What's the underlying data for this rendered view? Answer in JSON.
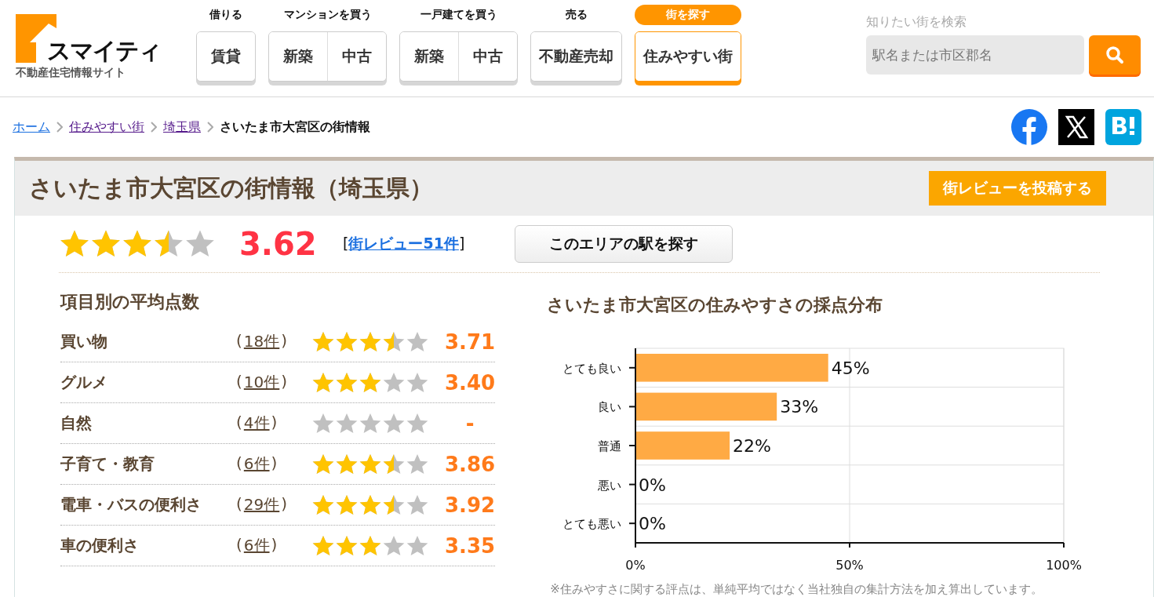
{
  "logo": {
    "name": "スマイティ",
    "tagline": "不動産住宅情報サイト"
  },
  "nav": [
    {
      "heading": "借りる",
      "selected": false,
      "buttons": [
        "賃貸"
      ]
    },
    {
      "heading": "マンションを買う",
      "selected": false,
      "buttons": [
        "新築",
        "中古"
      ]
    },
    {
      "heading": "一戸建てを買う",
      "selected": false,
      "buttons": [
        "新築",
        "中古"
      ]
    },
    {
      "heading": "売る",
      "selected": false,
      "buttons": [
        "不動産売却"
      ]
    },
    {
      "heading": "街を探す",
      "selected": true,
      "buttons": [
        "住みやすい街"
      ]
    }
  ],
  "search": {
    "label": "知りたい街を検索",
    "placeholder": "駅名または市区郡名"
  },
  "breadcrumb": [
    {
      "label": "ホーム",
      "kind": "link"
    },
    {
      "label": "住みやすい街",
      "kind": "visited"
    },
    {
      "label": "埼玉県",
      "kind": "visited"
    },
    {
      "label": "さいたま市大宮区の街情報",
      "kind": "current"
    }
  ],
  "page_title": "さいたま市大宮区の街情報（埼玉県）",
  "review_button": "街レビューを投稿する",
  "overall": {
    "stars": 3.5,
    "score": "3.62",
    "bracket_open": "[",
    "review_link": "街レビュー51件",
    "bracket_close": "]",
    "station_button": "このエリアの駅を探す"
  },
  "categories": {
    "title": "項目別の平均点数",
    "rows": [
      {
        "name": "買い物",
        "open": "(",
        "count": "18件",
        "close": ")",
        "stars": 3.5,
        "score": "3.71"
      },
      {
        "name": "グルメ",
        "open": "(",
        "count": "10件",
        "close": ")",
        "stars": 3,
        "score": "3.40"
      },
      {
        "name": "自然",
        "open": "(",
        "count": "4件",
        "close": ")",
        "stars": 0,
        "score": "-"
      },
      {
        "name": "子育て・教育",
        "open": "(",
        "count": "6件",
        "close": ")",
        "stars": 3.5,
        "score": "3.86"
      },
      {
        "name": "電車・バスの便利さ",
        "open": "(",
        "count": "29件",
        "close": ")",
        "stars": 3.5,
        "score": "3.92"
      },
      {
        "name": "車の便利さ",
        "open": "(",
        "count": "6件",
        "close": ")",
        "stars": 3,
        "score": "3.35"
      }
    ]
  },
  "distribution": {
    "title": "さいたま市大宮区の住みやすさの採点分布",
    "chart_data": {
      "type": "bar",
      "orientation": "horizontal",
      "categories": [
        "とても良い",
        "良い",
        "普通",
        "悪い",
        "とても悪い"
      ],
      "series": [
        {
          "color": "#ffaa44",
          "values": [
            45,
            33,
            22,
            0,
            0
          ]
        }
      ],
      "xlim": [
        0,
        100
      ],
      "xticks": [
        {
          "value": 0,
          "label": "0%"
        },
        {
          "value": 50,
          "label": "50%"
        },
        {
          "value": 100,
          "label": "100%"
        }
      ],
      "value_labels": [
        "45%",
        "33%",
        "22%",
        "0%",
        "0%"
      ]
    },
    "note": "※住みやすさに関する評点は、単純平均ではなく当社独自の集計方法を加え算出しています。"
  }
}
